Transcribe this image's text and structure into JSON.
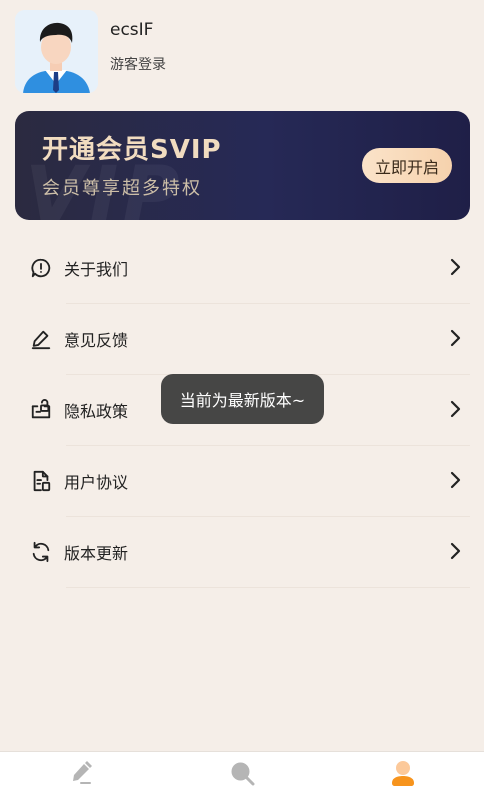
{
  "profile": {
    "username": "ecsIF",
    "status": "游客登录"
  },
  "vip": {
    "title": "开通会员SVIP",
    "subtitle": "会员尊享超多特权",
    "button_label": "立即开启",
    "watermark": "VIP"
  },
  "menu": {
    "items": [
      {
        "label": "关于我们",
        "icon": "info-chat-icon"
      },
      {
        "label": "意见反馈",
        "icon": "edit-pen-icon"
      },
      {
        "label": "隐私政策",
        "icon": "privacy-bag-icon"
      },
      {
        "label": "用户协议",
        "icon": "document-icon"
      },
      {
        "label": "版本更新",
        "icon": "refresh-icon"
      }
    ]
  },
  "toast": {
    "message": "当前为最新版本~"
  },
  "bottom_nav": {
    "items": [
      {
        "icon": "pencil-icon",
        "active": false
      },
      {
        "icon": "search-icon",
        "active": false
      },
      {
        "icon": "profile-icon",
        "active": true
      }
    ]
  },
  "colors": {
    "background": "#f5eee8",
    "vip_banner": "#262956",
    "vip_gold": "#f1dcc0",
    "accent_orange": "#f7941d",
    "nav_inactive": "#b5b5b5"
  }
}
